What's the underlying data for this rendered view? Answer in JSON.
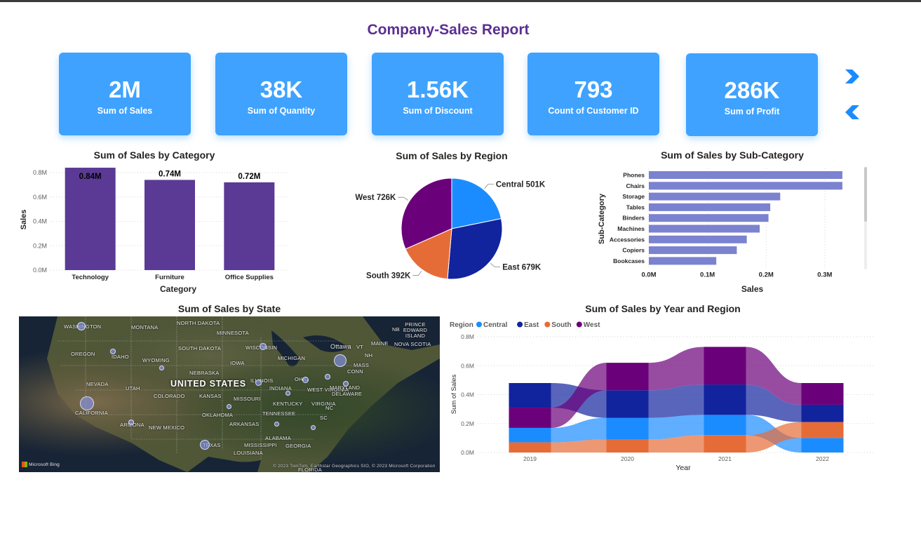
{
  "report_title": "Company-Sales Report",
  "kpis": [
    {
      "value": "2M",
      "label": "Sum of Sales"
    },
    {
      "value": "38K",
      "label": "Sum of Quantity"
    },
    {
      "value": "1.56K",
      "label": "Sum of Discount"
    },
    {
      "value": "793",
      "label": "Count of Customer ID"
    },
    {
      "value": "286K",
      "label": "Sum of Profit"
    }
  ],
  "nav_icons": {
    "next": "chevron-right-icon",
    "prev": "chevron-left-icon"
  },
  "colors": {
    "title": "#5b2f91",
    "card": "#3fa2ff",
    "bar": "#5a3a94",
    "hbar": "#7b82cf",
    "central": "#1b8cff",
    "east": "#12239e",
    "south": "#e66c37",
    "west": "#6b007b",
    "chevron": "#1b8cff"
  },
  "category_chart": {
    "title": "Sum of Sales by Category",
    "chart_data": {
      "type": "bar",
      "categories": [
        "Technology",
        "Furniture",
        "Office Supplies"
      ],
      "values": [
        0.84,
        0.74,
        0.72
      ],
      "data_labels": [
        "0.84M",
        "0.74M",
        "0.72M"
      ],
      "xlabel": "Category",
      "ylabel": "Sales",
      "yticks": [
        "0.0M",
        "0.2M",
        "0.4M",
        "0.6M",
        "0.8M"
      ],
      "ylim": [
        0,
        0.8
      ],
      "grid": true
    }
  },
  "region_chart": {
    "title": "Sum of Sales by Region",
    "chart_data": {
      "type": "pie",
      "slices": [
        {
          "label": "Central",
          "value": 501,
          "text": "Central 501K"
        },
        {
          "label": "East",
          "value": 679,
          "text": "East 679K"
        },
        {
          "label": "South",
          "value": 392,
          "text": "South 392K"
        },
        {
          "label": "West",
          "value": 726,
          "text": "West 726K"
        }
      ]
    }
  },
  "subcat_chart": {
    "title": "Sum of Sales by Sub-Category",
    "chart_data": {
      "type": "bar",
      "orientation": "horizontal",
      "categories": [
        "Phones",
        "Chairs",
        "Storage",
        "Tables",
        "Binders",
        "Machines",
        "Accessories",
        "Copiers",
        "Bookcases"
      ],
      "values": [
        0.33,
        0.33,
        0.224,
        0.207,
        0.204,
        0.189,
        0.167,
        0.15,
        0.115
      ],
      "xlabel": "Sales",
      "ylabel": "Sub-Category",
      "xticks": [
        "0.0M",
        "0.1M",
        "0.2M",
        "0.3M"
      ],
      "xlim": [
        0,
        0.36
      ],
      "grid": true
    }
  },
  "map_chart": {
    "title": "Sum of Sales by State",
    "country_label": "UNITED STATES",
    "state_labels": [
      "WASHINGTON",
      "MONTANA",
      "NORTH DAKOTA",
      "MINNESOTA",
      "OREGON",
      "IDAHO",
      "WYOMING",
      "SOUTH DAKOTA",
      "WISCONSIN",
      "MICHIGAN",
      "IOWA",
      "NEBRASKA",
      "NEVADA",
      "UTAH",
      "COLORADO",
      "KANSAS",
      "MISSOURI",
      "ILLINOIS",
      "INDIANA",
      "OHIO",
      "CALIFORNIA",
      "ARIZONA",
      "NEW MEXICO",
      "OKLAHOMA",
      "ARKANSAS",
      "TENNESSEE",
      "KENTUCKY",
      "WEST VIRGINIA",
      "VIRGINIA",
      "TEXAS",
      "MISSISSIPPI",
      "ALABAMA",
      "GEORGIA",
      "LOUISIANA",
      "FLORIDA",
      "MARYLAND",
      "DELAWARE",
      "MAINE",
      "NOVA SCOTIA",
      "NB",
      "PRINCE EDWARD ISLAND",
      "Ottawa",
      "VT",
      "NH",
      "MASS",
      "CONN",
      "SC",
      "NC"
    ],
    "attribution_logo": "Microsoft Bing",
    "copyright": "© 2023 TomTom, Earthstar Geographics SIO, © 2023 Microsoft Corporation"
  },
  "year_region_chart": {
    "title": "Sum of Sales by Year and Region",
    "chart_data": {
      "type": "area",
      "subtype": "ribbon",
      "legend_title": "Region",
      "legend_position": "top-left",
      "x": [
        "2019",
        "2020",
        "2021",
        "2022"
      ],
      "series": [
        {
          "name": "Central",
          "values": [
            0.1,
            0.15,
            0.14,
            0.1
          ]
        },
        {
          "name": "East",
          "values": [
            0.17,
            0.19,
            0.21,
            0.12
          ]
        },
        {
          "name": "South",
          "values": [
            0.07,
            0.09,
            0.12,
            0.11
          ]
        },
        {
          "name": "West",
          "values": [
            0.14,
            0.19,
            0.26,
            0.15
          ]
        }
      ],
      "xlabel": "Year",
      "ylabel": "Sum of Sales",
      "yticks": [
        "0.0M",
        "0.2M",
        "0.4M",
        "0.6M",
        "0.8M"
      ],
      "ylim": [
        0,
        0.8
      ],
      "grid": true
    }
  }
}
